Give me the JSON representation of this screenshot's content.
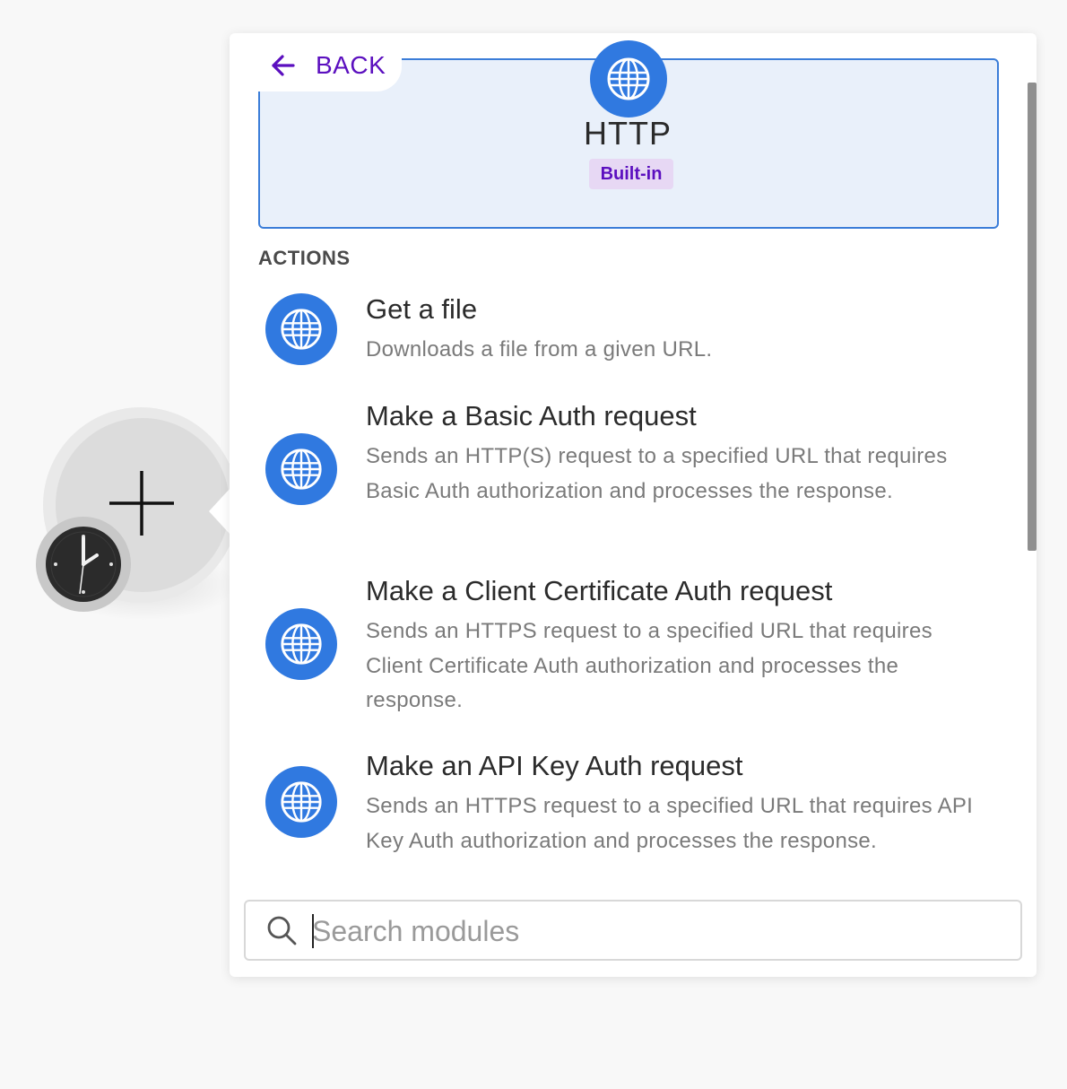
{
  "panel": {
    "back_label": "BACK",
    "app": {
      "title": "HTTP",
      "badge": "Built-in",
      "icon": "globe-icon"
    },
    "section_heading": "ACTIONS",
    "actions": [
      {
        "title": "Get a file",
        "description": "Downloads a file from a given URL.",
        "icon": "globe-icon"
      },
      {
        "title": "Make a Basic Auth request",
        "description": "Sends an HTTP(S) request to a specified URL that requires Basic Auth authorization and processes the response.",
        "icon": "globe-icon"
      },
      {
        "title": "Make a Client Certificate Auth request",
        "description": "Sends an HTTPS request to a specified URL that requires Client Certificate Auth authorization and processes the response.",
        "icon": "globe-icon"
      },
      {
        "title": "Make an API Key Auth request",
        "description": "Sends an HTTPS request to a specified URL that requires API Key Auth authorization and processes the response.",
        "icon": "globe-icon"
      }
    ],
    "search": {
      "placeholder": "Search modules",
      "value": ""
    }
  },
  "node": {
    "icon": "plus-icon",
    "badge_icon": "clock-icon"
  },
  "colors": {
    "accent_purple": "#5b0fbf",
    "http_blue": "#3079e0",
    "card_border": "#3b7dd8",
    "card_background": "#e9f0fa",
    "badge_background": "#e7d8f4"
  }
}
